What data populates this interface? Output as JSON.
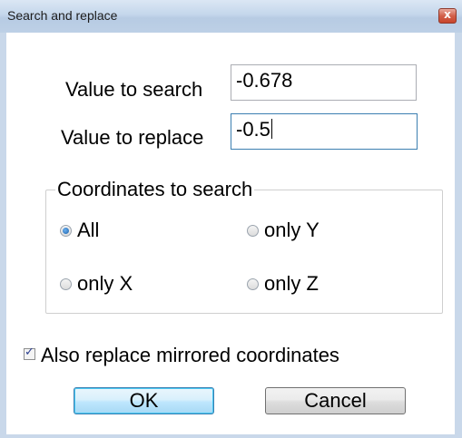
{
  "window": {
    "title": "Search and replace",
    "close_glyph": "x"
  },
  "search": {
    "label": "Value to search",
    "value": "-0.678"
  },
  "replace": {
    "label": "Value to replace",
    "value": "-0.5"
  },
  "coordinates": {
    "legend": "Coordinates to search",
    "options": [
      {
        "label": "All",
        "checked": true
      },
      {
        "label": "only Y",
        "checked": false
      },
      {
        "label": "only X",
        "checked": false
      },
      {
        "label": "only Z",
        "checked": false
      }
    ]
  },
  "mirrored": {
    "label": "Also replace mirrored coordinates",
    "checked": true
  },
  "buttons": {
    "ok": "OK",
    "cancel": "Cancel"
  },
  "colors": {
    "accent": "#3c7fb1",
    "close_red": "#c8442b"
  }
}
